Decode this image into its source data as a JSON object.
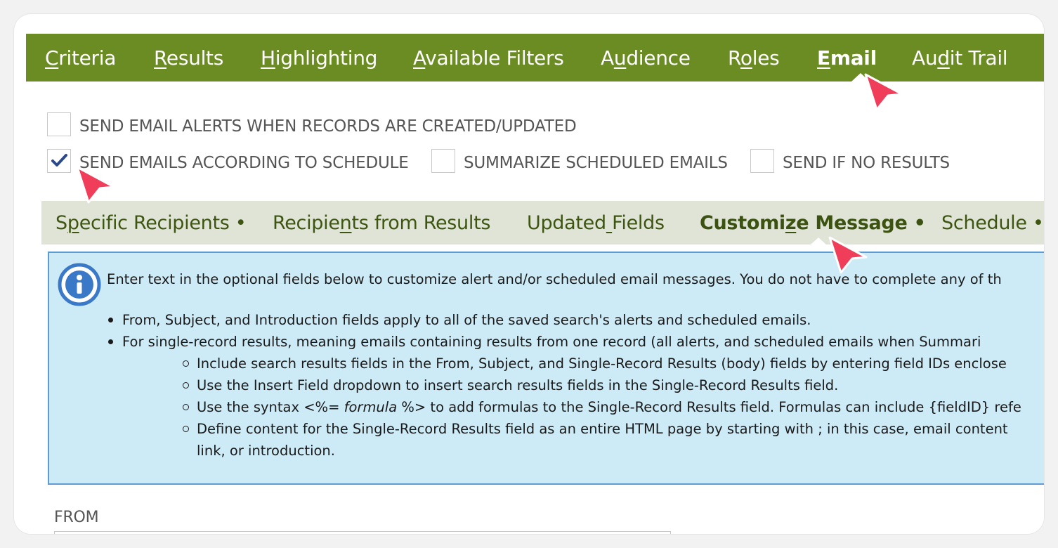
{
  "main_tabs": [
    {
      "pre": "",
      "acc": "C",
      "post": "riteria",
      "active": false
    },
    {
      "pre": "",
      "acc": "R",
      "post": "esults",
      "active": false
    },
    {
      "pre": "",
      "acc": "H",
      "post": "ighlighting",
      "active": false
    },
    {
      "pre": "",
      "acc": "A",
      "post": "vailable Filters",
      "active": false
    },
    {
      "pre": "A",
      "acc": "u",
      "post": "dience",
      "active": false
    },
    {
      "pre": "R",
      "acc": "o",
      "post": "les",
      "active": false
    },
    {
      "pre": "",
      "acc": "E",
      "post": "mail",
      "active": true
    },
    {
      "pre": "Au",
      "acc": "d",
      "post": "it Trail",
      "active": false
    }
  ],
  "checkboxes": [
    {
      "label": "SEND EMAIL ALERTS WHEN RECORDS ARE CREATED/UPDATED",
      "checked": false
    },
    {
      "label": "SEND EMAILS ACCORDING TO SCHEDULE",
      "checked": true
    },
    {
      "label": "SUMMARIZE SCHEDULED EMAILS",
      "checked": false
    },
    {
      "label": "SEND IF NO RESULTS",
      "checked": false
    }
  ],
  "sub_tabs": [
    {
      "pre": "S",
      "acc": "p",
      "post": "ecific Recipients •",
      "active": false
    },
    {
      "pre": "Recipie",
      "acc": "n",
      "post": "ts from Results",
      "active": false
    },
    {
      "pre": "Updated",
      "acc": " ",
      "post": "Fields",
      "active": false
    },
    {
      "pre": "Customi",
      "acc": "z",
      "post": "e Message •",
      "active": true
    },
    {
      "pre": "Schedule •",
      "acc": "",
      "post": "",
      "active": false
    }
  ],
  "info": {
    "lead": "Enter text in the optional fields below to customize alert and/or scheduled email messages. You do not have to complete any of th",
    "bullets": [
      "From, Subject, and Introduction fields apply to all of the saved search's alerts and scheduled emails.",
      "For single-record results, meaning emails containing results from one record (all alerts, and scheduled emails when Summari"
    ],
    "sub_bullets": [
      {
        "pre": "Include search results fields in the From, Subject, and Single-Record Results (body) fields by entering field IDs enclose",
        "em": "",
        "post": ""
      },
      {
        "pre": "Use the Insert Field dropdown to insert search results fields in the Single-Record Results field.",
        "em": "",
        "post": ""
      },
      {
        "pre": "Use the syntax <%= ",
        "em": "formula",
        "post": " %> to add formulas to the Single-Record Results field. Formulas can include {fieldID} refe"
      },
      {
        "pre": "Define content for the Single-Record Results field as an entire HTML page by starting with ; in this case, email content",
        "em": "",
        "post": "",
        "cont": "link, or introduction."
      }
    ]
  },
  "from": {
    "label": "FROM",
    "value": ""
  },
  "colors": {
    "tab_bar": "#6a8c22",
    "sub_tab_bar": "#dfe4d6",
    "info_bg": "#cdebf7",
    "info_border": "#5e9bd3",
    "pointer": "#ef3d5a"
  }
}
